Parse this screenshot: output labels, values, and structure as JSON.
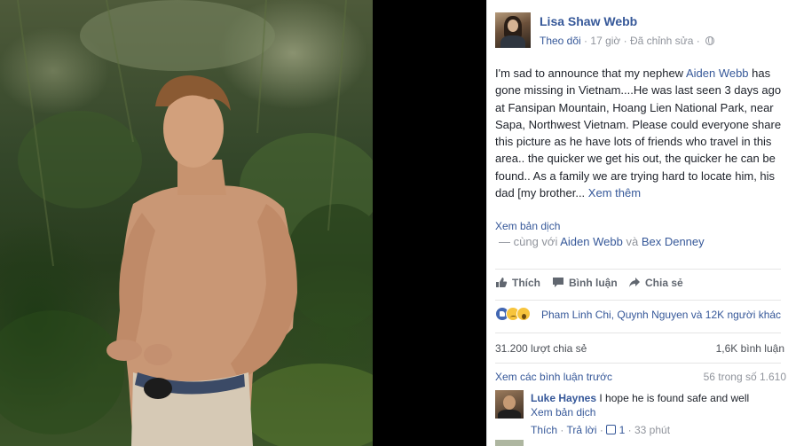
{
  "post": {
    "author": "Lisa Shaw Webb",
    "follow": "Theo dõi",
    "time": "17 giờ",
    "edited": "Đã chỉnh sửa",
    "sep": "·",
    "text_1": "I'm sad to announce that my nephew ",
    "text_link": "Aiden Webb",
    "text_2": " has gone missing in Vietnam....He was last seen 3 days ago at Fansipan Mountain, Hoang Lien National Park, near Sapa, Northwest Vietnam. Please could everyone share this picture as he have lots of friends who travel in this area.. the quicker we get his out, the quicker he can be found.. As a family we are trying hard to locate him, his dad [my brother...",
    "see_more": "Xem thêm",
    "translate": "Xem bản dịch",
    "with_prefix": "— cùng với",
    "with_1": "Aiden Webb",
    "with_and": "và",
    "with_2": "Bex Denney"
  },
  "actions": {
    "like": "Thích",
    "comment": "Bình luận",
    "share": "Chia sẻ"
  },
  "reactions": {
    "text": "Pham Linh Chi, Quynh Nguyen và 12K người khác"
  },
  "stats": {
    "shares": "31.200 lượt chia sẻ",
    "comments": "1,6K bình luận"
  },
  "comments_section": {
    "view_previous": "Xem các bình luận trước",
    "count": "56 trong số 1.610"
  },
  "comment": {
    "author": "Luke Haynes",
    "text": " I hope he is found safe and well",
    "translate": "Xem bản dịch",
    "like": "Thích",
    "reply": "Trả lời",
    "sep": "·",
    "likes": "1",
    "time": "33 phút"
  },
  "colors": {
    "link": "#365899",
    "muted": "#90949c",
    "text": "#1d2129"
  }
}
